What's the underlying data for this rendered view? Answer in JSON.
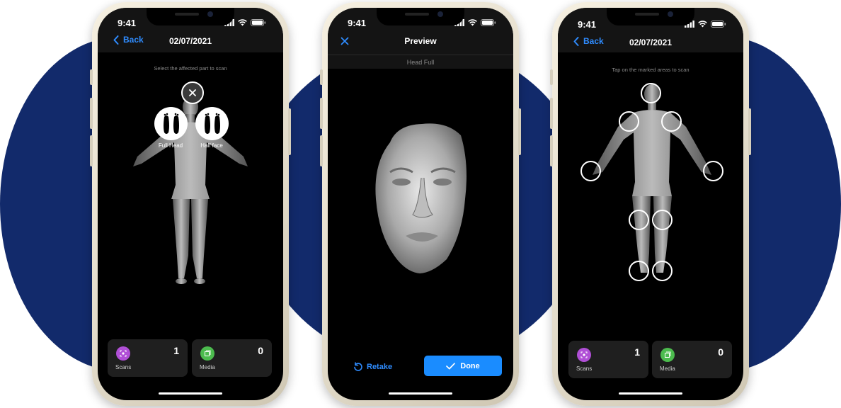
{
  "status": {
    "time": "9:41"
  },
  "phone1": {
    "nav_back": "Back",
    "nav_title": "02/07/2021",
    "hint": "Select the affected part to scan",
    "options": [
      {
        "label": "Full Head",
        "icon": "feet-icon"
      },
      {
        "label": "Half face",
        "icon": "feet-icon"
      }
    ],
    "cards": [
      {
        "label": "Scans",
        "count": "1",
        "icon": "scan-icon",
        "color": "#b04fd6"
      },
      {
        "label": "Media",
        "count": "0",
        "icon": "media-icon",
        "color": "#4cbb4e"
      }
    ]
  },
  "phone2": {
    "title": "Preview",
    "subtitle": "Head Full",
    "retake_label": "Retake",
    "done_label": "Done"
  },
  "phone3": {
    "nav_back": "Back",
    "nav_title": "02/07/2021",
    "hint": "Tap on the marked areas to scan",
    "cards": [
      {
        "label": "Scans",
        "count": "1",
        "icon": "scan-icon",
        "color": "#b04fd6"
      },
      {
        "label": "Media",
        "count": "0",
        "icon": "media-icon",
        "color": "#4cbb4e"
      }
    ]
  },
  "colors": {
    "accent": "#2f8cff",
    "background_blob": "#122a6b",
    "done_button": "#1a8cff"
  }
}
